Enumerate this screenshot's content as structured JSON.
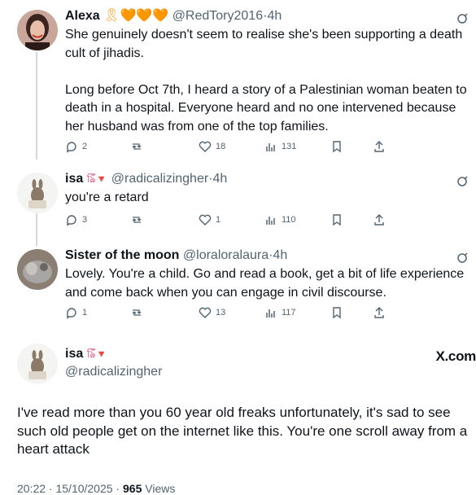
{
  "tweets": [
    {
      "name": "Alexa",
      "emoji": "🎗🧡🧡🧡",
      "handle": "@RedTory2016",
      "time": "4h",
      "text": "She genuinely doesn't seem to realise she's been supporting a death cult of jihadis.\n\nLong before Oct 7th, I heard a story of a Palestinian woman beaten to death in a hospital. Everyone heard and no one intervened because her husband was from one of the top families.",
      "replies": "2",
      "retweets": "",
      "likes": "18",
      "views": "131"
    },
    {
      "name": "isa",
      "emoji": "ঌিঁঁ🔻",
      "handle": "@radicalizingher",
      "time": "4h",
      "text": "you're a retard",
      "replies": "3",
      "retweets": "",
      "likes": "1",
      "views": "110"
    },
    {
      "name": "Sister of the moon",
      "emoji": "",
      "handle": "@loraloralaura",
      "time": "4h",
      "text": "Lovely. You're a child. Go and read a book, get a bit of life experience and come back when you can engage in civil discourse.",
      "replies": "1",
      "retweets": "",
      "likes": "13",
      "views": "117"
    }
  ],
  "main": {
    "name": "isa",
    "emoji": "ঌিঁঁ🔻",
    "handle": "@radicalizingher",
    "brand": "X.com",
    "text": "I've read more than you 60 year old freaks unfortunately, it's sad to see such old people get on the internet like this. You're one scroll away from a heart attack",
    "timestamp": "20:22 · 15/10/2025 · ",
    "views_count": "965",
    "views_label": " Views"
  },
  "icons": [
    "reply-icon",
    "retweet-icon",
    "like-icon",
    "views-icon",
    "bookmark-icon",
    "share-icon",
    "grok-icon"
  ],
  "colors": {
    "text": "#0f1419",
    "secondary": "#536471",
    "thread_line": "#cfd9de",
    "badge": "#e0245e"
  }
}
